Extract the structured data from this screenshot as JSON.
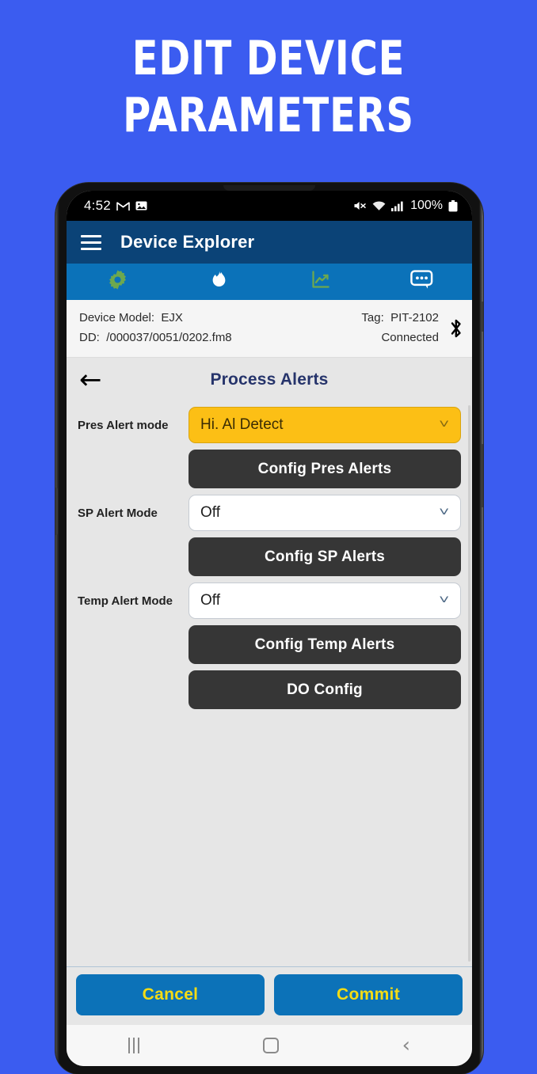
{
  "promo": {
    "line1": "EDIT DEVICE",
    "line2": "PARAMETERS",
    "background_color": "#3B5CF0",
    "text_color": "#FFFFFF"
  },
  "status_bar": {
    "time": "4:52",
    "battery_percent": "100%",
    "icons": [
      "gmail-icon",
      "photo-icon",
      "mute-icon",
      "wifi-icon",
      "signal-icon",
      "battery-icon"
    ]
  },
  "app_bar": {
    "menu_icon": "hamburger-menu-icon",
    "title": "Device Explorer",
    "background_color": "#0B4377"
  },
  "tab_bar": {
    "background_color": "#0B72B9",
    "tabs": [
      {
        "name": "gear-icon",
        "color": "#6DA84E"
      },
      {
        "name": "flame-icon",
        "color": "#FFFFFF"
      },
      {
        "name": "chart-line-icon",
        "color": "#6DA84E"
      },
      {
        "name": "message-icon",
        "color": "#FFFFFF"
      }
    ]
  },
  "device_info": {
    "model_label": "Device Model:",
    "model_value": "EJX",
    "dd_label": "DD:",
    "dd_value": "/000037/0051/0202.fm8",
    "tag_label": "Tag:",
    "tag_value": "PIT-2102",
    "connection_status": "Connected",
    "bluetooth_icon": "bluetooth-icon"
  },
  "page": {
    "back_icon": "back-arrow-icon",
    "title": "Process Alerts",
    "title_color": "#26346B"
  },
  "form": {
    "rows": [
      {
        "label": "Pres Alert mode",
        "select_value": "Hi. Al Detect",
        "select_style": "highlight",
        "select_bg": "#FCBF15",
        "button_label": "Config Pres Alerts"
      },
      {
        "label": "SP Alert Mode",
        "select_value": "Off",
        "select_style": "plain",
        "select_bg": "#FFFFFF",
        "button_label": "Config SP Alerts"
      },
      {
        "label": "Temp Alert Mode",
        "select_value": "Off",
        "select_style": "plain",
        "select_bg": "#FFFFFF",
        "button_label": "Config Temp Alerts"
      }
    ],
    "extra_button_label": "DO Config",
    "button_color": "#363636"
  },
  "actions": {
    "cancel_label": "Cancel",
    "commit_label": "Commit",
    "button_bg": "#0C72B8",
    "button_text_color": "#F5DC14"
  },
  "nav_bar": {
    "recent_icon": "recent-apps-icon",
    "home_icon": "home-icon",
    "back_icon": "nav-back-icon"
  }
}
